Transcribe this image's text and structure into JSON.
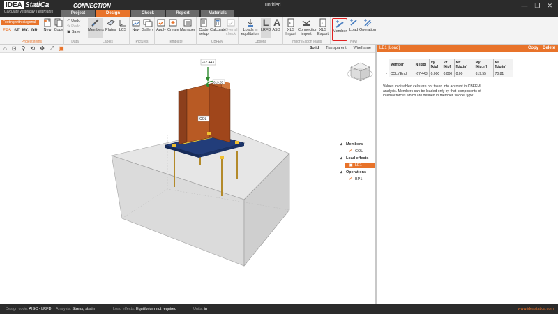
{
  "app": {
    "brand": "IDEA StatiCa",
    "tagline": "Calculate yesterday's estimates",
    "product": "CONNECTION",
    "document": "untitled",
    "window_controls": [
      "—",
      "❐",
      "✕"
    ]
  },
  "tabs": [
    {
      "label": "Project"
    },
    {
      "label": "Design"
    },
    {
      "label": "Check"
    },
    {
      "label": "Report"
    },
    {
      "label": "Materials"
    }
  ],
  "ribbon": {
    "project_items": {
      "current": "Footing with diagonal",
      "codes": [
        "EPS",
        "ST",
        "MC",
        "DR"
      ],
      "new": "New",
      "copy": "Copy",
      "label": "Project items"
    },
    "data": {
      "undo": "Undo",
      "redo": "Redo",
      "save": "Save",
      "label": "Data"
    },
    "labels": {
      "members": "Members",
      "plates": "Plates",
      "lcs": "LCS",
      "label": "Labels"
    },
    "pictures": {
      "new": "New",
      "gallery": "Gallery",
      "label": "Pictures"
    },
    "template": {
      "apply": "Apply",
      "create": "Create",
      "manager": "Manager",
      "label": "Template"
    },
    "cbfem": {
      "code_setup": "Code setup",
      "calculate": "Calculate",
      "overall_check": "Overall check",
      "label": "CBFEM"
    },
    "options": {
      "loads_in_equilibrium": "Loads in equilibrium",
      "lrfd": "LRFD",
      "asd": "ASD",
      "label": "Options"
    },
    "import_export": {
      "xls_import": "XLS Import",
      "connection_import": "Connection import",
      "xls_export": "XLS Export",
      "label": "Import/Export loads"
    },
    "new": {
      "member": "Member",
      "load": "Load",
      "operation": "Operation",
      "label": "New"
    }
  },
  "viewbar": {
    "modes": [
      "Solid",
      "Transparent",
      "Wireframe"
    ],
    "icons": [
      "home-icon",
      "zoom-icon",
      "search-icon",
      "rotate-icon",
      "move-icon",
      "fit-icon"
    ]
  },
  "scene": {
    "load_label_1": "-67.443",
    "load_label_2": "619.55",
    "member_label": "COL"
  },
  "tree": {
    "members_title": "Members",
    "members": [
      "COL"
    ],
    "loads_title": "Load effects",
    "loads": [
      "LE1"
    ],
    "operations_title": "Operations",
    "operations": [
      "BP1"
    ]
  },
  "rpanel": {
    "header": "LE1   [Load]",
    "copy": "Copy",
    "delete": "Delete",
    "table": {
      "headers": [
        "Member",
        "N [kip]",
        "Vy [kip]",
        "Vz [kip]",
        "Mx [kip.in]",
        "My [kip.in]",
        "Mz [kip.in]"
      ],
      "row": [
        "COL / End",
        "-67.443",
        "0.000",
        "0.000",
        "0.00",
        "619.55",
        "70.81"
      ]
    },
    "note": "Values in disabled cells are not taken into account in CBFEM analysis. Members can be loaded only by that components of internal forces which are defined in member \"Model type\"."
  },
  "status": {
    "code_label": "Design code:",
    "code": "AISC - LRFD",
    "analysis_label": "Analysis:",
    "analysis": "Stress, strain",
    "load_label": "Load effects:",
    "load": "Equilibrium not required",
    "units_label": "Units:",
    "units": "in",
    "site": "www.ideastatica.com"
  },
  "colors": {
    "accent": "#e8732a",
    "dark": "#2b2b2b",
    "ribbon": "#f3f3f3"
  }
}
